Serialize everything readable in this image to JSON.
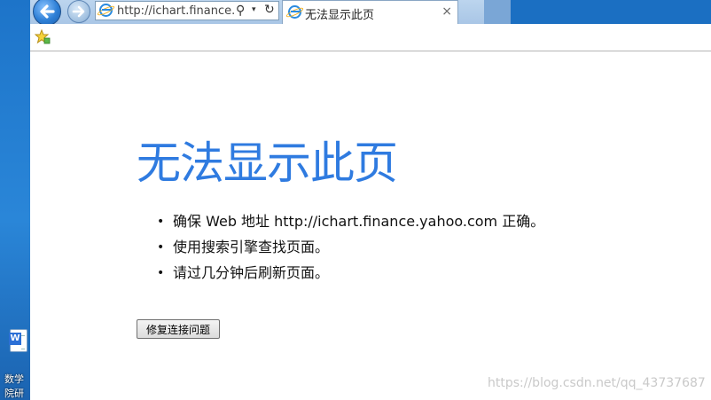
{
  "desktop": {
    "icon_letter": "W",
    "label_line1": "数学",
    "label_line2": "院研"
  },
  "browser": {
    "address": "http://ichart.finance.y...",
    "tab_title": "无法显示此页",
    "tab_close": "×",
    "search_glyph": "⚲",
    "dropdown_glyph": "▾",
    "refresh_glyph": "↻"
  },
  "page": {
    "title": "无法显示此页",
    "bullets": [
      "确保 Web 地址 http://ichart.finance.yahoo.com 正确。",
      "使用搜索引擎查找页面。",
      "请过几分钟后刷新页面。"
    ],
    "fix_button": "修复连接问题"
  },
  "watermark": "https://blog.csdn.net/qq_43737687",
  "colors": {
    "title_blue": "#2f7be0",
    "desktop_blue": "#1b6fc2",
    "ie_blue": "#2b8be0",
    "ie_ring": "#f2b01e"
  },
  "icons": [
    "back-arrow-icon",
    "forward-arrow-icon",
    "ie-logo-icon",
    "search-icon",
    "refresh-icon",
    "close-icon",
    "favorites-star-icon",
    "word-doc-icon"
  ]
}
